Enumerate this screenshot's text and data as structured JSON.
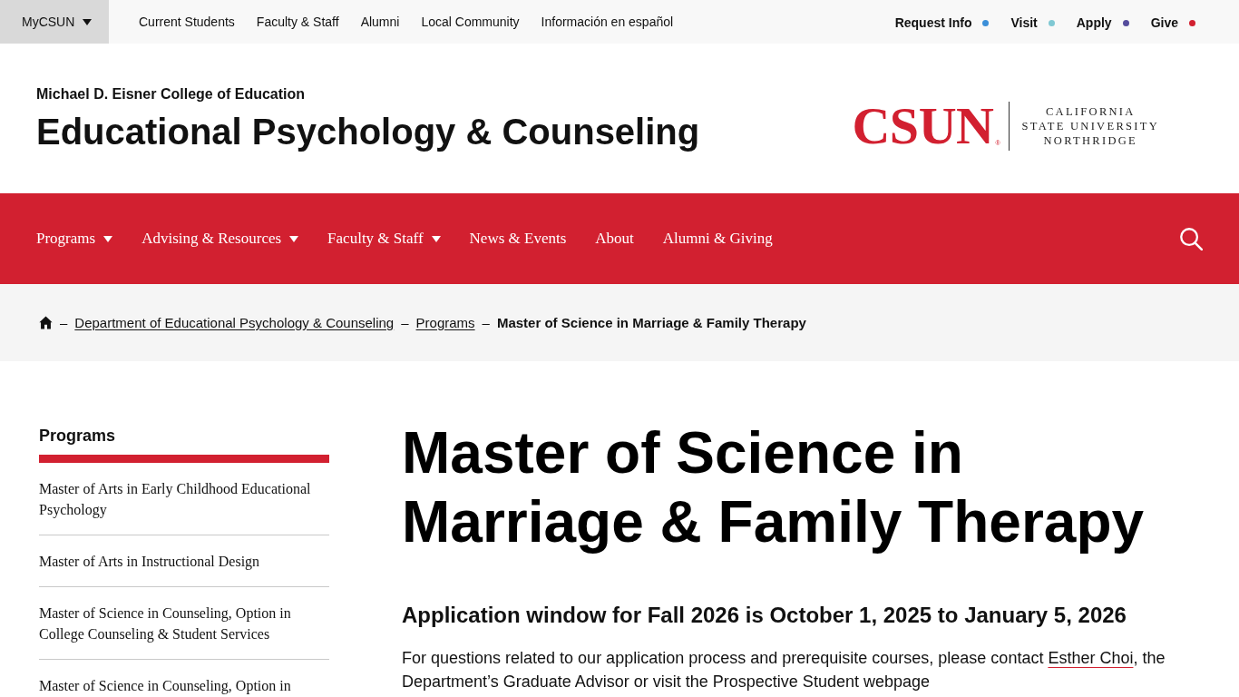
{
  "utility_bar": {
    "account_menu": {
      "label": "MyCSUN"
    },
    "links": [
      "Current Students",
      "Faculty & Staff",
      "Alumni",
      "Local Community",
      "Información en español"
    ],
    "actions": [
      {
        "label": "Request Info",
        "color": "#3b8fd8"
      },
      {
        "label": "Visit",
        "color": "#7fc8d3"
      },
      {
        "label": "Apply",
        "color": "#554c9c"
      },
      {
        "label": "Give",
        "color": "#d22030"
      }
    ]
  },
  "header": {
    "college": "Michael D. Eisner College of Education",
    "department": "Educational Psychology & Counseling",
    "logo": {
      "wordmark": "CSUN",
      "registered": "®",
      "lines": [
        "CALIFORNIA",
        "STATE UNIVERSITY",
        "NORTHRIDGE"
      ]
    }
  },
  "main_nav": {
    "items": [
      {
        "label": "Programs",
        "kind": "menu"
      },
      {
        "label": "Advising & Resources",
        "kind": "menu"
      },
      {
        "label": "Faculty & Staff",
        "kind": "menu"
      },
      {
        "label": "News & Events",
        "kind": "link"
      },
      {
        "label": "About",
        "kind": "link"
      },
      {
        "label": "Alumni & Giving",
        "kind": "link"
      }
    ]
  },
  "breadcrumb": {
    "items": [
      {
        "separator": "–",
        "text": "Department of Educational Psychology & Counseling",
        "kind": "link"
      },
      {
        "separator": "–",
        "text": "Programs",
        "kind": "link"
      },
      {
        "separator": "–",
        "text": "Master of Science in Marriage & Family Therapy",
        "kind": "current"
      }
    ]
  },
  "sidebar": {
    "title": "Programs",
    "items": [
      "Master of Arts in Early Childhood Educational Psychology",
      "Master of Arts in Instructional Design",
      "Master of Science in Counseling, Option in College Counseling & Student Services",
      "Master of Science in Counseling, Option in"
    ]
  },
  "main": {
    "title": "Master of Science in Marriage & Family Therapy",
    "notice": "Application window for Fall 2026 is October 1, 2025 to January 5, 2026",
    "intro": [
      {
        "kind": "text",
        "text": "For questions related to our application process and prerequisite courses, please contact "
      },
      {
        "kind": "link",
        "text": "Esther Choi"
      },
      {
        "kind": "text",
        "text": ", the Department’s Graduate Advisor or visit the Prospective Student webpage"
      }
    ]
  }
}
